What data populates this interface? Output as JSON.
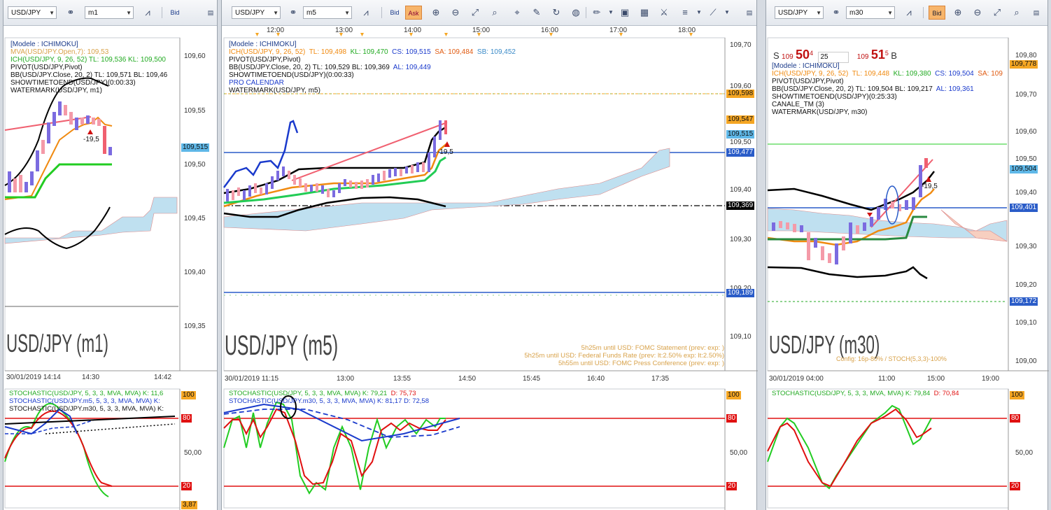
{
  "left": {
    "toolbar": {
      "symbol": "USD/JPY",
      "timeframe": "m1",
      "bid_label": "Bid"
    },
    "indicators": [
      {
        "text": "[Modele : ICHIMOKU]",
        "color": "#1a3a8a"
      },
      {
        "text": "MVA(USD/JPY.Open,7): 109,53",
        "color": "#d8a24a"
      },
      {
        "text": "ICH(USD/JPY, 9, 26, 52)  TL: 109,536  KL: 109,500",
        "color": "#22aa22"
      },
      {
        "text": "PIVOT(USD/JPY,Pivot)",
        "color": "#111111"
      },
      {
        "text": "BB(USD/JPY.Close, 20, 2)  TL: 109,571  BL: 109,46",
        "color": "#111111"
      },
      {
        "text": "SHOWTIMETOEND(USD/JPY)(0:00:33)",
        "color": "#111111"
      },
      {
        "text": "WATERMARK(USD/JPY, m1)",
        "color": "#111111"
      }
    ],
    "price_ticks": [
      "109,60",
      "109,55",
      "109,50",
      "109,45",
      "109,40",
      "109,35"
    ],
    "price_tag": "109,515",
    "annotation": "-19,5",
    "watermark": "USD/JPY (m1)",
    "time_ticks": [
      "30/01/2019 14:14",
      "14:30",
      "14:42"
    ],
    "stoch_labels": [
      {
        "text": "STOCHASTIC(USD/JPY, 5, 3, 3, MVA, MVA)  K: 11,6",
        "color": "#22aa22"
      },
      {
        "text": "STOCHASTIC(USD/JPY.m5, 5, 3, 3, MVA, MVA)  K:",
        "color": "#1a3acc"
      },
      {
        "text": "STOCHASTIC(USD/JPY.m30, 5, 3, 3, MVA, MVA)  K:",
        "color": "#111111"
      }
    ],
    "stoch_ticks": [
      "100",
      "80",
      "50,00",
      "20"
    ],
    "stoch_tag": "3,87"
  },
  "middle": {
    "toolbar": {
      "symbol": "USD/JPY",
      "timeframe": "m5",
      "bid_label": "Bid",
      "ask_label": "Ask"
    },
    "top_times": [
      "12:00",
      "13:00",
      "14:00",
      "15:00",
      "16:00",
      "17:00",
      "18:00"
    ],
    "indicators": [
      {
        "text": "[Modele : ICHIMOKU]",
        "color": "#1a3a8a"
      },
      {
        "text": "PIVOT(USD/JPY,Pivot)",
        "color": "#111111"
      },
      {
        "text": "BB(USD/JPY.Close, 20, 2)  TL: 109,529  BL: 109,369",
        "color": "#111111"
      },
      {
        "text": "SHOWTIMETOEND(USD/JPY)(0:00:33)",
        "color": "#111111"
      },
      {
        "text": "PRO CALENDAR",
        "color": "#1a3acc"
      },
      {
        "text": "WATERMARK(USD/JPY, m5)",
        "color": "#111111"
      }
    ],
    "ich_line": {
      "prefix": "ICH(USD/JPY, 9, 26, 52)",
      "tl": "TL: 109,498",
      "kl": "KL: 109,470",
      "cs": "CS: 109,515",
      "sa": "SA: 109,484",
      "sb": "SB: 109,452",
      "bl": "AL: 109,449"
    },
    "price_ticks": [
      "109,70",
      "109,60",
      "109,50",
      "109,40",
      "109,30",
      "109,20",
      "109,10"
    ],
    "price_tags": [
      {
        "text": "109,598",
        "bg": "#f5a623",
        "fg": "#111111"
      },
      {
        "text": "109,547",
        "bg": "#f5a623",
        "fg": "#111111"
      },
      {
        "text": "109,515",
        "bg": "#5fb8e8",
        "fg": "#111111"
      },
      {
        "text": "109,477",
        "bg": "#2a5cc8",
        "fg": "#ffffff"
      },
      {
        "text": "109,369",
        "bg": "#000000",
        "fg": "#ffffff"
      },
      {
        "text": "109,189",
        "bg": "#2a5cc8",
        "fg": "#ffffff"
      }
    ],
    "annotation": "-19,5",
    "watermark": "USD/JPY (m5)",
    "events": [
      "5h25m until USD: FOMC Statement (prev:  exp: )",
      "5h25m until USD: Federal Funds Rate (prev: lt:2.50% exp: lt:2.50%)",
      "5h55m until USD: FOMC Press Conference (prev:  exp: )"
    ],
    "time_ticks": [
      "30/01/2019 11:15",
      "13:00",
      "13:55",
      "14:50",
      "15:45",
      "16:40",
      "17:35"
    ],
    "stoch_labels": [
      {
        "text": "STOCHASTIC(USD/JPY, 5, 3, 3, MVA, MVA)  K: 79,21",
        "color": "#22aa22",
        "extra": "D: 75,73"
      },
      {
        "text": "STOCHASTIC(USD/JPY.m30, 5, 3, 3, MVA, MVA)  K: 81,17  D: 72,58",
        "color": "#1a3acc"
      }
    ],
    "stoch_ticks": [
      "100",
      "80",
      "50,00",
      "20"
    ]
  },
  "right": {
    "toolbar": {
      "symbol": "USD/JPY",
      "timeframe": "m30",
      "bid_label": "Bid"
    },
    "quote": {
      "s": "S",
      "sbig": "109",
      "sprice": "50",
      "ssup": "4",
      "lots": "25",
      "bbig": "109",
      "bprice": "51",
      "bsup": "5",
      "b": "B"
    },
    "indicators": [
      {
        "text": "[Modele : ICHIMOKU]",
        "color": "#1a3a8a"
      },
      {
        "text": "PIVOT(USD/JPY,Pivot)",
        "color": "#111111"
      },
      {
        "text": "BB(USD/JPY.Close, 20, 2)  TL: 109,504  BL: 109,217",
        "color": "#111111"
      },
      {
        "text": "SHOWTIMETOEND(USD/JPY)(0:25:33)",
        "color": "#111111"
      },
      {
        "text": "CANALE_TM (3)",
        "color": "#111111"
      },
      {
        "text": "WATERMARK(USD/JPY, m30)",
        "color": "#111111"
      }
    ],
    "ich_line": {
      "prefix": "ICH(USD/JPY, 9, 26, 52)",
      "tl": "TL: 109,448",
      "kl": "KL: 109,380",
      "cs": "CS: 109,504",
      "sa": "SA: 109",
      "bl": "AL: 109,361"
    },
    "price_ticks": [
      "109,80",
      "109,70",
      "109,60",
      "109,50",
      "109,40",
      "109,30",
      "109,20",
      "109,10",
      "109,00"
    ],
    "price_tags": [
      {
        "text": "109,778",
        "bg": "#f5a623",
        "fg": "#111111"
      },
      {
        "text": "109,504",
        "bg": "#5fb8e8",
        "fg": "#111111"
      },
      {
        "text": "109,401",
        "bg": "#2a5cc8",
        "fg": "#ffffff"
      },
      {
        "text": "109,172",
        "bg": "#2a5cc8",
        "fg": "#ffffff"
      }
    ],
    "annotation": "-19,5",
    "watermark": "USD/JPY (m30)",
    "config": "Config: 16p-80% / STOCH(5,3,3)-100%",
    "time_ticks": [
      "30/01/2019 04:00",
      "11:00",
      "15:00",
      "19:00"
    ],
    "stoch_labels": [
      {
        "text": "STOCHASTIC(USD/JPY, 5, 3, 3, MVA, MVA)  K: 79,84",
        "color": "#22aa22",
        "extra": "D: 70,84"
      }
    ],
    "stoch_ticks": [
      "100",
      "80",
      "50,00",
      "20"
    ]
  }
}
